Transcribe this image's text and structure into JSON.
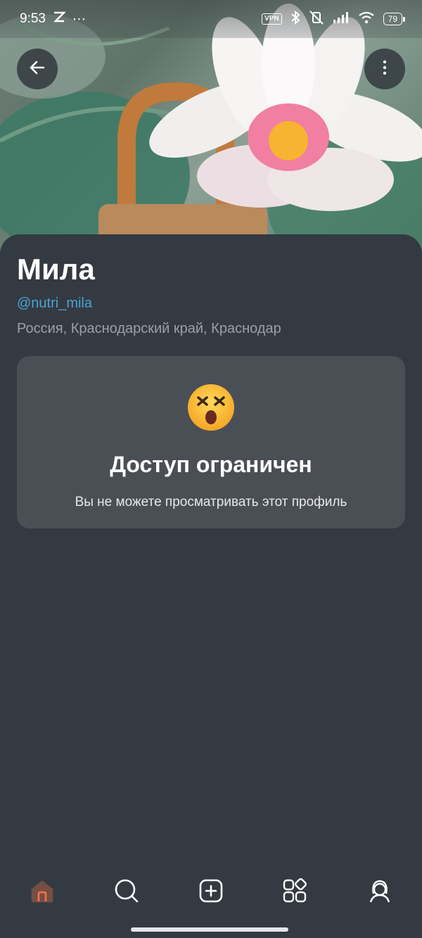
{
  "status_bar": {
    "time": "9:53",
    "extra_icons": "⋯",
    "vpn_label": "VPN",
    "battery": "79"
  },
  "profile": {
    "name": "Мила",
    "handle": "@nutri_mila",
    "location": "Россия, Краснодарский край, Краснодар"
  },
  "restricted": {
    "title": "Доступ ограничен",
    "subtitle": "Вы не можете просматривать этот профиль"
  },
  "nav": {
    "items": [
      {
        "icon": "home-icon",
        "active": true
      },
      {
        "icon": "search-icon"
      },
      {
        "icon": "add-icon"
      },
      {
        "icon": "apps-icon"
      },
      {
        "icon": "profile-icon"
      }
    ]
  },
  "colors": {
    "background": "#343a41",
    "card": "#4a4f56",
    "accent_link": "#4aa3d6",
    "nav_active": "#f0744a"
  }
}
